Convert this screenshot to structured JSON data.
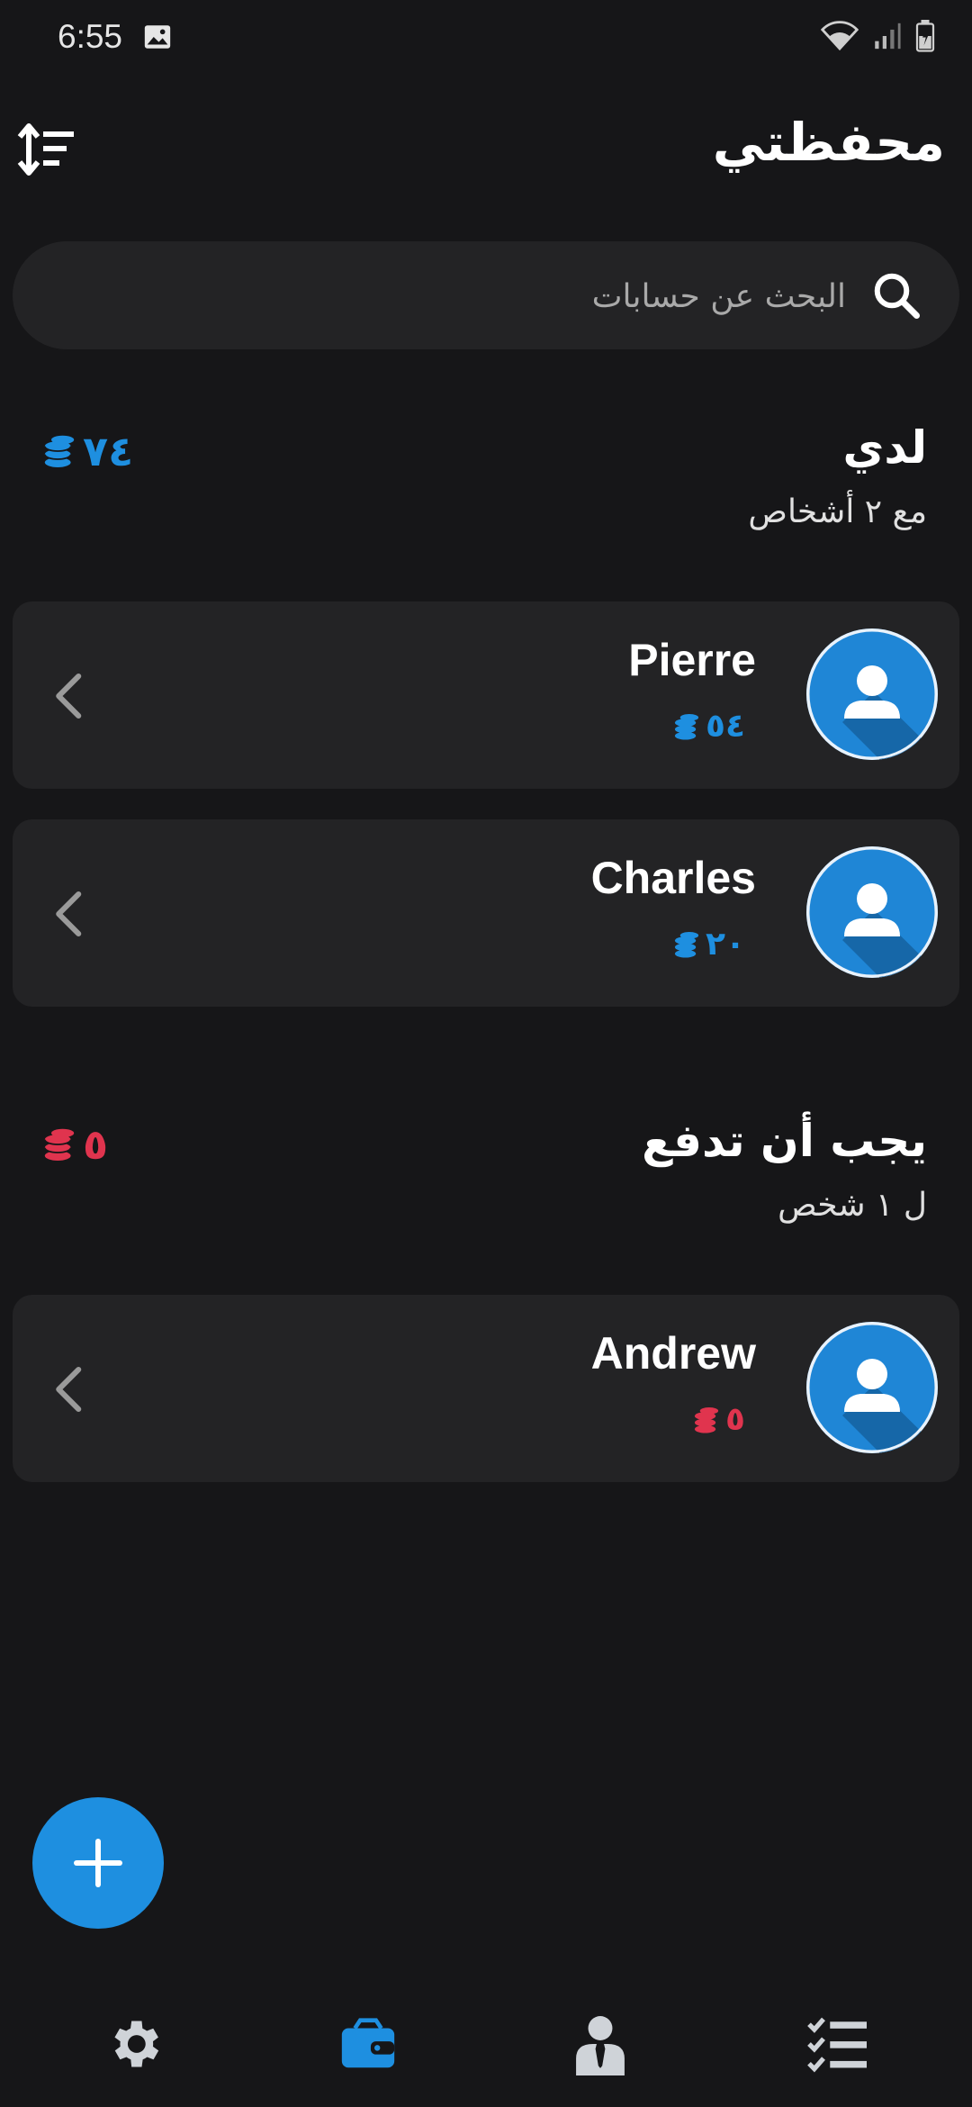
{
  "status_bar": {
    "time": "6:55",
    "icons": [
      "image-icon",
      "wifi-icon",
      "signal-icon",
      "battery-icon"
    ]
  },
  "header": {
    "title": "محفظتي",
    "sort_icon": "sort-icon"
  },
  "search": {
    "placeholder": "البحث عن حسابات",
    "icon": "search-icon"
  },
  "sections": [
    {
      "title": "لدي",
      "subtitle": "مع ٢ أشخاص",
      "total": "٧٤",
      "color": "#1e8fe0",
      "items": [
        {
          "name": "Pierre",
          "amount": "٥٤"
        },
        {
          "name": "Charles",
          "amount": "٢٠"
        }
      ]
    },
    {
      "title": "يجب أن تدفع",
      "subtitle": "ل ١ شخص",
      "total": "٥",
      "color": "#e0344e",
      "items": [
        {
          "name": "Andrew",
          "amount": "٥"
        }
      ]
    }
  ],
  "bottom_nav": {
    "items": [
      "settings-icon",
      "wallet-icon",
      "person-icon",
      "checklist-icon"
    ],
    "active_index": 1,
    "active_color": "#1e8fe0",
    "inactive_color": "#cfd3d8"
  },
  "fab": {
    "icon": "plus-icon"
  }
}
